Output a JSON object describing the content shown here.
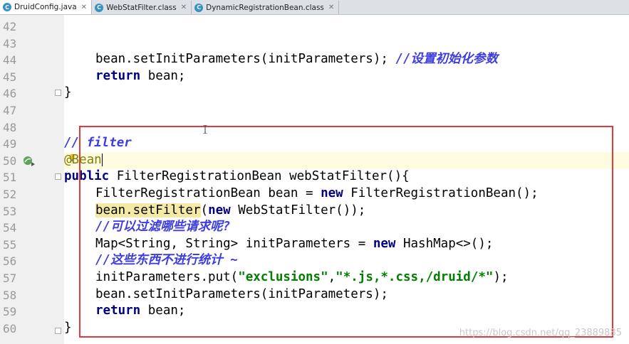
{
  "tabs": [
    {
      "label": "DruidConfig.java",
      "active": true
    },
    {
      "label": "WebStatFilter.class",
      "active": false
    },
    {
      "label": "DynamicRegistrationBean.class",
      "active": false
    }
  ],
  "line_numbers": [
    "42",
    "43",
    "44",
    "45",
    "46",
    "47",
    "48",
    "49",
    "50",
    "51",
    "52",
    "53",
    "54",
    "55",
    "56",
    "57",
    "58",
    "59",
    "60"
  ],
  "code": {
    "l44_a": "bean.setInitParameters(initParameters); ",
    "l44_c": "//设置初始化参数",
    "l45_kw": "return",
    "l45_b": " bean;",
    "l46": "}",
    "l49": "// filter",
    "l50": "@Bean",
    "l51_kw": "public",
    "l51_b": " FilterRegistrationBean webStatFilter(){",
    "l52_a": "FilterRegistrationBean bean = ",
    "l52_kw": "new",
    "l52_b": " FilterRegistrationBean();",
    "l53_hl": "bean.setFilter",
    "l53_a": "(",
    "l53_kw": "new",
    "l53_b": " WebStatFilter());",
    "l54": "//可以过滤哪些请求呢?",
    "l55_a": "Map<String, String> initParameters = ",
    "l55_kw": "new",
    "l55_b": " HashMap<>();",
    "l56": "//这些东西不进行统计 ~",
    "l57_a": "initParameters.put(",
    "l57_s1": "\"exclusions\"",
    "l57_b": ",",
    "l57_s2": "\"*.js,*.css,/druid/*\"",
    "l57_c": ");",
    "l58": "bean.setInitParameters(initParameters);",
    "l59_kw": "return",
    "l59_b": " bean;",
    "l60": "}"
  },
  "watermark": "https://blog.csdn.net/qq_23889885",
  "colors": {
    "keyword": "#000080",
    "comment": "#3d3de0",
    "string": "#008000",
    "annotation": "#808000",
    "highlight_box": "#e03a3a"
  }
}
